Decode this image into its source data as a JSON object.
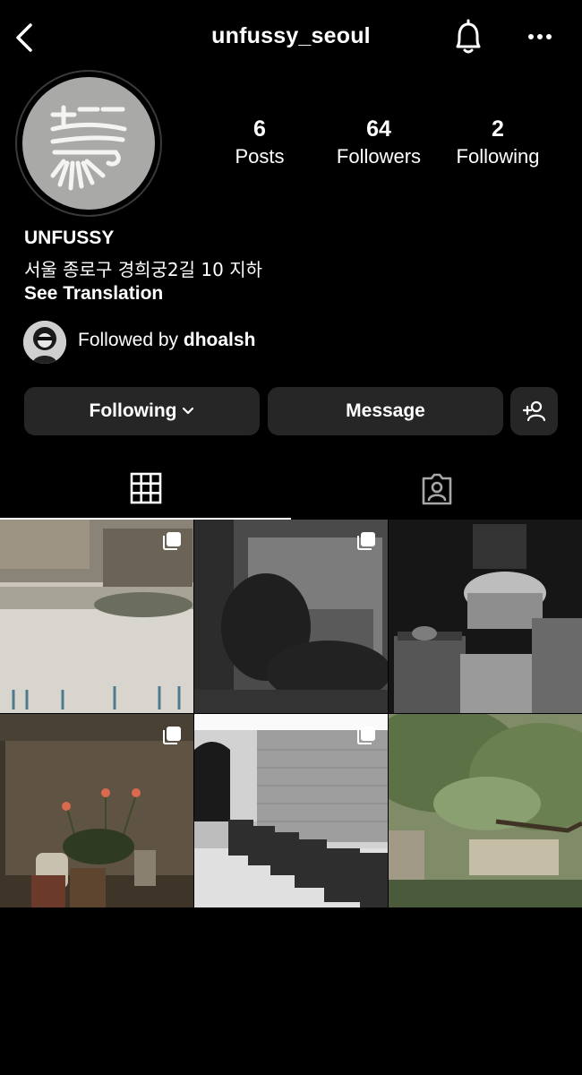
{
  "header": {
    "username": "unfussy_seoul"
  },
  "profile": {
    "stats": [
      {
        "value": "6",
        "label": "Posts"
      },
      {
        "value": "64",
        "label": "Followers"
      },
      {
        "value": "2",
        "label": "Following"
      }
    ],
    "display_name": "UNFUSSY",
    "bio": "서울 종로구 경희궁2길 10 지하",
    "see_translation": "See Translation",
    "followed_by_prefix": "Followed by ",
    "followed_by_user": "dhoalsh"
  },
  "actions": {
    "following_label": "Following",
    "message_label": "Message"
  },
  "icons": {
    "back": "chevron-left-icon",
    "notifications": "bell-icon",
    "more": "more-horizontal-icon",
    "dropdown": "chevron-down-icon",
    "add_user": "add-user-icon",
    "grid_tab": "grid-icon",
    "tagged_tab": "tagged-person-icon",
    "multi_post": "carousel-icon"
  },
  "colors": {
    "background": "#000000",
    "button": "#262626",
    "text": "#ffffff"
  }
}
